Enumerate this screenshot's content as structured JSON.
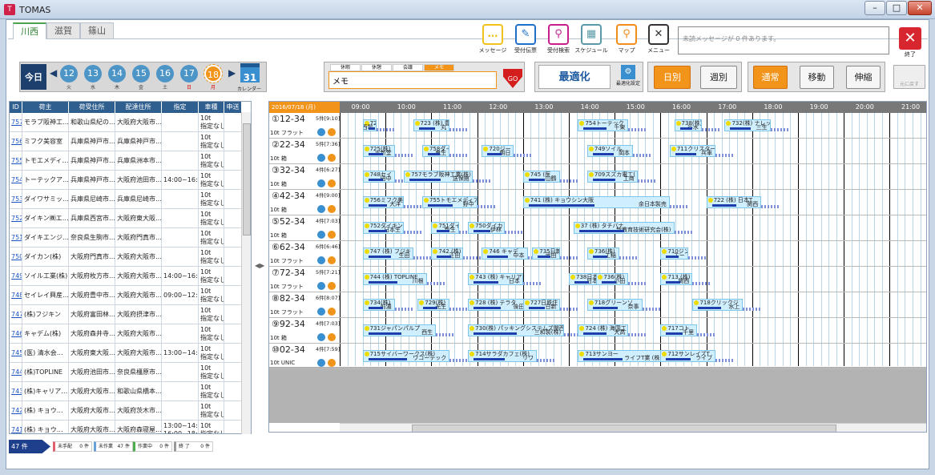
{
  "window": {
    "title": "TOMAS",
    "app_icon": "T"
  },
  "tabs": [
    "川西",
    "滋賀",
    "篠山"
  ],
  "toolbar": [
    {
      "label": "メッセージ",
      "icon": "message-icon",
      "color": "#f2c21a"
    },
    {
      "label": "受付伝票",
      "icon": "form-icon",
      "color": "#1e6fc8"
    },
    {
      "label": "受付検索",
      "icon": "search-icon",
      "color": "#c81e8c"
    },
    {
      "label": "スケジュール",
      "icon": "truck-icon",
      "color": "#5a9aa8"
    },
    {
      "label": "マップ",
      "icon": "map-pin-icon",
      "color": "#f28c1a"
    },
    {
      "label": "メニュー",
      "icon": "tools-icon",
      "color": "#333333"
    }
  ],
  "message": "未読メッセージが 0 件あります。",
  "exit_label": "終了",
  "today_label": "今日",
  "dates": [
    {
      "d": "12",
      "w": "火"
    },
    {
      "d": "13",
      "w": "水"
    },
    {
      "d": "14",
      "w": "木"
    },
    {
      "d": "15",
      "w": "金"
    },
    {
      "d": "16",
      "w": "土"
    },
    {
      "d": "17",
      "w": "日"
    },
    {
      "d": "18",
      "w": "月"
    }
  ],
  "calendar": {
    "icon_text": "31",
    "label": "カレンダー"
  },
  "memo_tabs": [
    "休暇",
    "休憩",
    "会議",
    "メモ"
  ],
  "memo_value": "メモ",
  "go_label": "GO",
  "optimize": {
    "label": "最適化",
    "settings_label": "最適化設定"
  },
  "view_buttons": [
    "日別",
    "週別"
  ],
  "mode_buttons": [
    "通常",
    "移動",
    "伸縮"
  ],
  "back_label": "元に戻す",
  "table": {
    "headers": [
      "ID",
      "荷主",
      "荷受住所",
      "配達住所",
      "指定",
      "車種",
      "申送"
    ],
    "rows": [
      [
        "757",
        "モラブ阪神工…",
        "和歌山県紀の…",
        "大阪府大阪市…",
        "",
        "10t|指定なし"
      ],
      [
        "756",
        "ミフク美容室",
        "兵庫県神戸市…",
        "兵庫県神戸市…",
        "",
        "10t|指定なし"
      ],
      [
        "755",
        "トモエメディ…",
        "兵庫県神戸市…",
        "兵庫県洲本市…",
        "",
        "10t|指定なし"
      ],
      [
        "754",
        "トーテックア…",
        "兵庫県神戸市…",
        "大阪府池田市…",
        "14:00~16:00",
        "10t|指定なし"
      ],
      [
        "753",
        "ダイワサミッ…",
        "兵庫県尼崎市…",
        "兵庫県尼崎市…",
        "",
        "10t|指定なし"
      ],
      [
        "752",
        "ダイキン㈱エ…",
        "兵庫県西宮市…",
        "大阪府東大阪…",
        "",
        "10t|指定なし"
      ],
      [
        "751",
        "ダイキエンジ…",
        "奈良県生駒市…",
        "大阪府門真市…",
        "",
        "10t|指定なし"
      ],
      [
        "750",
        "ダイカン(株)",
        "大阪府門真市…",
        "大阪府大阪市…",
        "",
        "10t|指定なし"
      ],
      [
        "749",
        "ソイル工業(株)",
        "大阪府枚方市…",
        "大阪府大阪市…",
        "14:00~16:00",
        "10t|指定なし"
      ],
      [
        "748",
        "セイレイ興産…",
        "大阪府豊中市…",
        "大阪府大阪市…",
        "09:00~12:00",
        "10t|指定なし"
      ],
      [
        "747",
        "(株)フジキン",
        "大阪府富田林…",
        "大阪府摂津市…",
        "",
        "10t|指定なし"
      ],
      [
        "746",
        "キャデム(株)",
        "大阪府森井寺…",
        "大阪府大阪市…",
        "",
        "10t|指定なし"
      ],
      [
        "745",
        "(医) 清水会…",
        "大阪府東大阪…",
        "大阪府大阪市…",
        "13:00~14:00",
        "10t|指定なし"
      ],
      [
        "744",
        "(株)TOPLINE",
        "大阪府池田市…",
        "奈良県橿原市…",
        "",
        "10t|指定なし"
      ],
      [
        "743",
        "(株)キャリア…",
        "大阪府大阪市…",
        "和歌山県橋本…",
        "",
        "10t|指定なし"
      ],
      [
        "742",
        "(株) キョウ…",
        "大阪府大阪市…",
        "大阪府茨木市…",
        "",
        "10t|指定なし"
      ],
      [
        "741",
        "(株) キョウ…",
        "大阪府大阪市…",
        "大阪府森寝屋…",
        "13:00~14:00|16:00~18:00",
        "10t|指定なし"
      ]
    ]
  },
  "gantt": {
    "date": "2016/07/18 (月)",
    "hours": [
      "09:00",
      "10:00",
      "11:00",
      "12:00",
      "13:00",
      "14:00",
      "15:00",
      "16:00",
      "17:00",
      "18:00",
      "19:00",
      "20:00",
      "21:00"
    ],
    "vehicles": [
      {
        "name": "①12-34",
        "count": "5件[9:10]",
        "type": "10t フラット",
        "bars": [
          {
            "s": 9.0,
            "e": 9.3,
            "t": "726(株)",
            "u": "川西製"
          },
          {
            "s": 10.1,
            "e": 10.9,
            "t": "723 (株) 豊",
            "u": "丸"
          },
          {
            "s": 13.7,
            "e": 14.8,
            "t": "754トーテック",
            "u": "千東"
          },
          {
            "s": 15.8,
            "e": 16.4,
            "t": "738(株)",
            "u": "谷水"
          },
          {
            "s": 16.9,
            "e": 17.9,
            "t": "732(株) ナレッジ",
            "u": "三生"
          }
        ]
      },
      {
        "name": "②22-34",
        "count": "5件[7:36]",
        "type": "10t 箱",
        "bars": [
          {
            "s": 9.0,
            "e": 9.7,
            "t": "725(株)",
            "u": "ボ新堂"
          },
          {
            "s": 10.3,
            "e": 10.9,
            "t": "758ダイ",
            "u": "鬼生"
          },
          {
            "s": 11.6,
            "e": 12.3,
            "t": "720ジー",
            "u": "朝日"
          },
          {
            "s": 13.9,
            "e": 14.9,
            "t": "749ソイル",
            "u": "岡本"
          },
          {
            "s": 15.7,
            "e": 16.7,
            "t": "711クリスター",
            "u": "兵車"
          }
        ]
      },
      {
        "name": "③32-34",
        "count": "4件[6:27]",
        "type": "10t 箱",
        "bars": [
          {
            "s": 9.0,
            "e": 9.7,
            "t": "748セイ",
            "u": "田中"
          },
          {
            "s": 9.9,
            "e": 11.4,
            "t": "757モラブ阪神工業(株)",
            "u": "送保館"
          },
          {
            "s": 12.5,
            "e": 13.3,
            "t": "745 (医",
            "u": "山鶴"
          },
          {
            "s": 13.9,
            "e": 15.0,
            "t": "709スズカ電工(",
            "u": "工商"
          }
        ]
      },
      {
        "name": "④42-34",
        "count": "4件[9:00]",
        "type": "10t 箱",
        "bars": [
          {
            "s": 9.0,
            "e": 9.9,
            "t": "756ミフク美容",
            "u": "大洋"
          },
          {
            "s": 10.3,
            "e": 11.5,
            "t": "755トモエメディア(",
            "u": "野中"
          },
          {
            "s": 12.5,
            "e": 15.7,
            "t": "741 (株) キョウシン大阪",
            "u": "余日本製売"
          },
          {
            "s": 16.5,
            "e": 17.7,
            "t": "722 (株) 日本T",
            "u": "関西"
          }
        ]
      },
      {
        "name": "⑤52-34",
        "count": "4件[7:03]",
        "type": "10t 箱",
        "bars": [
          {
            "s": 9.0,
            "e": 9.9,
            "t": "752ダイキン㈱",
            "u": "日本生"
          },
          {
            "s": 10.5,
            "e": 11.1,
            "t": "751ダイキ",
            "u": "新生"
          },
          {
            "s": 11.3,
            "e": 12.1,
            "t": "750ダイカ",
            "u": "伊林"
          },
          {
            "s": 13.6,
            "e": 15.8,
            "t": "37 (株) タチバナ",
            "u": "新教育技術研究会(株)"
          }
        ]
      },
      {
        "name": "⑥62-34",
        "count": "6件[6:46]",
        "type": "10t フラット",
        "bars": [
          {
            "s": 9.0,
            "e": 10.1,
            "t": "747 (株) フジキ",
            "u": "生田"
          },
          {
            "s": 10.5,
            "e": 11.2,
            "t": "742 (株)",
            "u": "正田"
          },
          {
            "s": 11.6,
            "e": 12.6,
            "t": "746 キャデ",
            "u": "中本"
          },
          {
            "s": 12.7,
            "e": 13.3,
            "t": "735日新",
            "u": "武田"
          },
          {
            "s": 13.9,
            "e": 14.6,
            "t": "736(株) トリ",
            "u": "工稲"
          },
          {
            "s": 15.5,
            "e": 16.1,
            "t": "710ジン",
            "u": "エー"
          }
        ]
      },
      {
        "name": "⑦72-34",
        "count": "5件[7:21]",
        "type": "10t フラット",
        "bars": [
          {
            "s": 9.0,
            "e": 10.4,
            "t": "744 (株) TOPLINE",
            "u": "川根"
          },
          {
            "s": 11.3,
            "e": 12.5,
            "t": "743 (株) キャリア",
            "u": "日本"
          },
          {
            "s": 13.5,
            "e": 14.2,
            "t": "738日本製",
            "u": "日本"
          },
          {
            "s": 14.1,
            "e": 14.8,
            "t": "736(株)",
            "u": "小田"
          },
          {
            "s": 15.5,
            "e": 16.2,
            "t": "713 (株)",
            "u": "関西"
          }
        ]
      },
      {
        "name": "⑧82-34",
        "count": "6件[8:07]",
        "type": "10t フラット",
        "bars": [
          {
            "s": 9.0,
            "e": 9.7,
            "t": "734(株)",
            "u": "前濃"
          },
          {
            "s": 10.2,
            "e": 10.9,
            "t": "729(株)",
            "u": "光生"
          },
          {
            "s": 11.3,
            "e": 12.6,
            "t": "728 (株) テラタ",
            "u": "後田"
          },
          {
            "s": 12.5,
            "e": 13.3,
            "t": "727日鉄住",
            "u": "日新"
          },
          {
            "s": 13.9,
            "e": 15.1,
            "t": "718グリーンソ",
            "u": "奈事"
          },
          {
            "s": 16.2,
            "e": 17.3,
            "t": "718クリックジ",
            "u": "水上"
          }
        ]
      },
      {
        "name": "⑨92-34",
        "count": "4件[7:03]",
        "type": "10t 箱",
        "bars": [
          {
            "s": 9.0,
            "e": 10.6,
            "t": "731ジャパンパルプ",
            "u": "西生"
          },
          {
            "s": 11.3,
            "e": 13.4,
            "t": "730(株) パッキングシステムズ関西",
            "u": "三和製(株)"
          },
          {
            "s": 13.7,
            "e": 14.8,
            "t": "724 (株) 海国工",
            "u": "大高"
          },
          {
            "s": 15.5,
            "e": 16.3,
            "t": "717コト",
            "u": "千里"
          }
        ]
      },
      {
        "name": "⑩02-34",
        "count": "4件[7:59]",
        "type": "10t UNIC",
        "bars": [
          {
            "s": 9.0,
            "e": 10.9,
            "t": "715サイバーワークス(株)",
            "u": "ワコーテック"
          },
          {
            "s": 11.3,
            "e": 12.8,
            "t": "714サラダカフェ(株)",
            "u": "リワ"
          },
          {
            "s": 13.7,
            "e": 15.6,
            "t": "713サンヨー",
            "u": "ライフT業 (株)"
          },
          {
            "s": 15.5,
            "e": 16.7,
            "t": "712サンレイズT",
            "u": "ライブ"
          }
        ]
      }
    ]
  },
  "status": {
    "total": "47 件",
    "items": [
      {
        "label": "未手配",
        "value": "0 件",
        "color": "#e06070"
      },
      {
        "label": "未作業",
        "value": "47 件",
        "color": "#6aa0d8"
      },
      {
        "label": "作業中",
        "value": "0 件",
        "color": "#4cae4c"
      },
      {
        "label": "終 了",
        "value": "0 件",
        "color": "#999999"
      }
    ]
  }
}
